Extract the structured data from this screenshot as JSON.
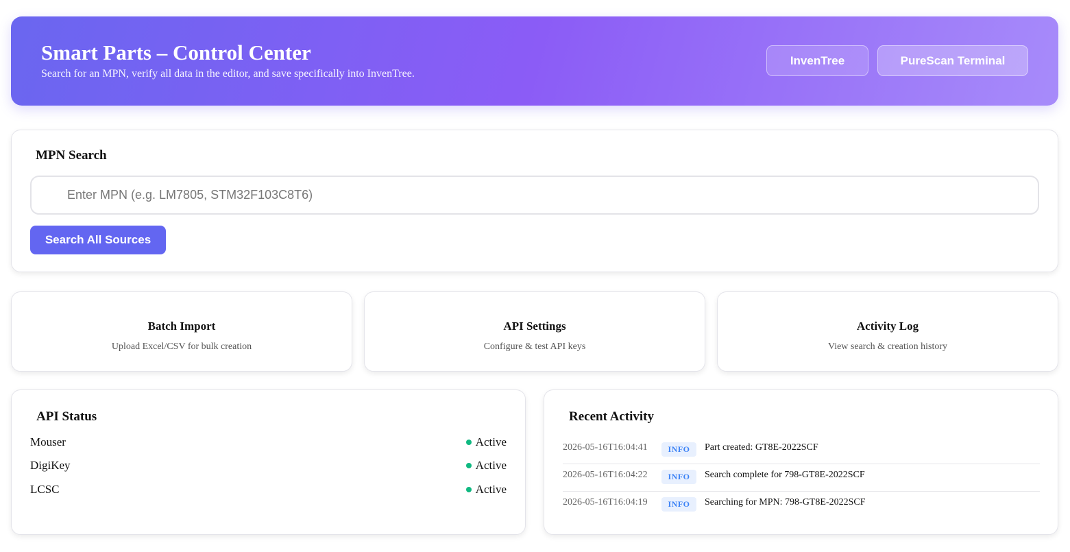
{
  "header": {
    "title": "Smart Parts – Control Center",
    "subtitle": "Search for an MPN, verify all data in the editor, and save specifically into InvenTree.",
    "buttons": {
      "inventree": "InvenTree",
      "purescan": "PureScan Terminal"
    }
  },
  "search": {
    "heading": "MPN Search",
    "placeholder": "Enter MPN (e.g. LM7805, STM32F103C8T6)",
    "value": "",
    "button": "Search All Sources"
  },
  "tiles": [
    {
      "title": "Batch Import",
      "description": "Upload Excel/CSV for bulk creation"
    },
    {
      "title": "API Settings",
      "description": "Configure & test API keys"
    },
    {
      "title": "Activity Log",
      "description": "View search & creation history"
    }
  ],
  "api_status": {
    "heading": "API Status",
    "status_color": "#10b981",
    "items": [
      {
        "source": "Mouser",
        "status": "Active"
      },
      {
        "source": "DigiKey",
        "status": "Active"
      },
      {
        "source": "LCSC",
        "status": "Active"
      }
    ]
  },
  "activity": {
    "heading": "Recent Activity",
    "entries": [
      {
        "time": "2026-05-16T16:04:41",
        "level": "INFO",
        "message": "Part created: GT8E-2022SCF"
      },
      {
        "time": "2026-05-16T16:04:22",
        "level": "INFO",
        "message": "Search complete for 798-GT8E-2022SCF"
      },
      {
        "time": "2026-05-16T16:04:19",
        "level": "INFO",
        "message": "Searching for MPN: 798-GT8E-2022SCF"
      }
    ]
  },
  "colors": {
    "accent": "#6366f1",
    "header_gradient_start": "#6a66f0",
    "header_gradient_end": "#a78bfa",
    "info_badge": "#3b82f6"
  }
}
